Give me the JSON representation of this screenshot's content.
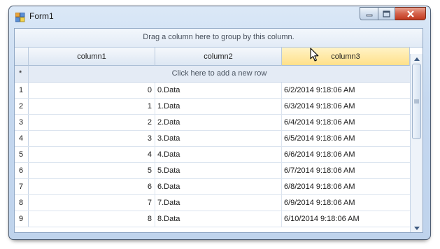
{
  "window": {
    "title": "Form1"
  },
  "group_panel": {
    "text": "Drag a column here to group by this column."
  },
  "columns": [
    "column1",
    "column2",
    "column3"
  ],
  "new_row": {
    "indicator": "*",
    "text": "Click here to add a new row"
  },
  "rows": [
    {
      "num": "1",
      "c1": "0",
      "c2": "0.Data",
      "c3": "6/2/2014 9:18:06 AM"
    },
    {
      "num": "2",
      "c1": "1",
      "c2": "1.Data",
      "c3": "6/3/2014 9:18:06 AM"
    },
    {
      "num": "3",
      "c1": "2",
      "c2": "2.Data",
      "c3": "6/4/2014 9:18:06 AM"
    },
    {
      "num": "4",
      "c1": "3",
      "c2": "3.Data",
      "c3": "6/5/2014 9:18:06 AM"
    },
    {
      "num": "5",
      "c1": "4",
      "c2": "4.Data",
      "c3": "6/6/2014 9:18:06 AM"
    },
    {
      "num": "6",
      "c1": "5",
      "c2": "5.Data",
      "c3": "6/7/2014 9:18:06 AM"
    },
    {
      "num": "7",
      "c1": "6",
      "c2": "6.Data",
      "c3": "6/8/2014 9:18:06 AM"
    },
    {
      "num": "8",
      "c1": "7",
      "c2": "7.Data",
      "c3": "6/9/2014 9:18:06 AM"
    },
    {
      "num": "9",
      "c1": "8",
      "c2": "8.Data",
      "c3": "6/10/2014 9:18:06 AM"
    }
  ],
  "hovered_column": "column3",
  "icons": {
    "app": "form-app-icon",
    "minimize": "minimize-icon",
    "maximize": "maximize-icon",
    "close": "close-icon",
    "scroll_up": "arrow-up-icon",
    "scroll_down": "arrow-down-icon",
    "grip": "scroll-grip-icon",
    "cursor": "mouse-pointer-icon"
  },
  "colors": {
    "hover_header": "#ffe08a",
    "close_button": "#d4614a",
    "frame": "#c5d8ef"
  }
}
